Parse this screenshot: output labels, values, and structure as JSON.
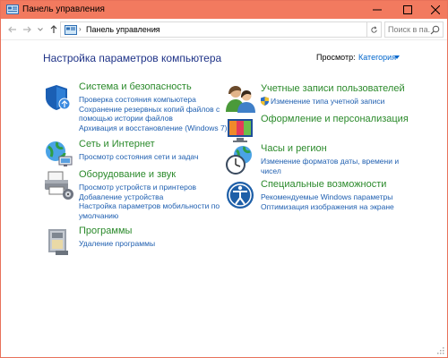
{
  "window": {
    "title": "Панель управления"
  },
  "address_bar": {
    "path": "Панель управления",
    "search_placeholder": "Поиск в па..."
  },
  "main": {
    "heading": "Настройка параметров компьютера",
    "view_label": "Просмотр:",
    "view_value": "Категория"
  },
  "categories": {
    "system": {
      "title": "Система и безопасность",
      "links": [
        "Проверка состояния компьютера",
        "Сохранение резервных копий файлов с",
        "помощью истории файлов",
        "Архивация и восстановление (Windows 7)"
      ]
    },
    "network": {
      "title": "Сеть и Интернет",
      "links": [
        "Просмотр состояния сети и задач"
      ]
    },
    "hardware": {
      "title": "Оборудование и звук",
      "links": [
        "Просмотр устройств и принтеров",
        "Добавление устройства",
        "Настройка параметров мобильности по",
        "умолчанию"
      ]
    },
    "programs": {
      "title": "Программы",
      "links": [
        "Удаление программы"
      ]
    },
    "users": {
      "title": "Учетные записи пользователей",
      "links": [
        "Изменение типа учетной записи"
      ]
    },
    "appearance": {
      "title": "Оформление и персонализация",
      "links": []
    },
    "clock": {
      "title": "Часы и регион",
      "links": [
        "Изменение форматов даты, времени и",
        "чисел"
      ]
    },
    "ease": {
      "title": "Специальные возможности",
      "links": [
        "Рекомендуемые Windows параметры",
        "Оптимизация изображения на экране"
      ]
    }
  },
  "colors": {
    "titlebar": "#f27a5f",
    "heading": "#1e3287",
    "category_title": "#2b8a2b",
    "link": "#1f5fb0"
  }
}
